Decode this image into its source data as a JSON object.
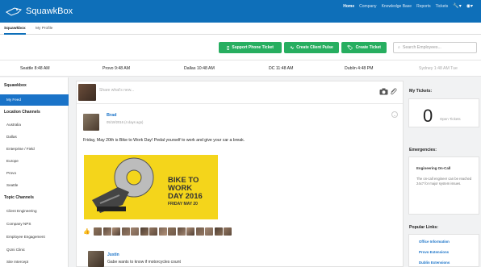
{
  "app": {
    "name": "SquawkBox"
  },
  "topnav": {
    "items": [
      "Home",
      "Company",
      "Knowledge Base",
      "Reports",
      "Tickets"
    ],
    "active": "Home",
    "tools_icon": "wrench-icon",
    "user_icon": "user-icon"
  },
  "subtabs": [
    "Squawkbox",
    "My Profile"
  ],
  "actions": {
    "phone_ticket": "Support Phone Ticket",
    "client_pulse": "Create Client Pulse",
    "create_ticket": "Create Ticket",
    "search_placeholder": "Search Employees..."
  },
  "clocks": [
    {
      "label": "Seattle 8:48 AM"
    },
    {
      "label": "Provo 9:48 AM"
    },
    {
      "label": "Dallas 10:48 AM"
    },
    {
      "label": "DC 11:48 AM"
    },
    {
      "label": "Dublin 4:48 PM"
    },
    {
      "label": "Sydney 1:48 AM Tue"
    }
  ],
  "sidebar": {
    "heading": "Squawkbox",
    "my_feed": "My Feed",
    "location_heading": "Location Channels",
    "locations": [
      "Australia",
      "Dallas",
      "Enterprise / Field",
      "Europe",
      "Provo",
      "Seattle"
    ],
    "topic_heading": "Topic Channels",
    "topics": [
      "Client Engineering",
      "Company NPS",
      "Employee Engagement",
      "QUni Clinic",
      "Site Intercept"
    ]
  },
  "composer": {
    "placeholder": "Share what's new..."
  },
  "post": {
    "author": "Brad",
    "date": "05/19/2016 (4 days ago)",
    "text": "Friday, May 20th is Bike to Work Day! Pedal yourself to work and give your car a break.",
    "banner": {
      "line1": "BIKE TO",
      "line2": "WORK",
      "line3": "DAY 2016",
      "line4": "FRIDAY MAY 20"
    },
    "like_count_faces": 15
  },
  "comment": {
    "author": "Justin",
    "text": "Gabe wants to know if motorcycles count"
  },
  "right": {
    "my_tickets": "My Tickets:",
    "ticket_count": "0",
    "open_tickets": "Open Tickets",
    "emergencies": "Emergencies:",
    "engineering_title": "Engineering On-Call",
    "engineering_text": "The on-call engineer can be reached 24x7 for major system issues.",
    "popular": "Popular Links:",
    "links": [
      "Office Information",
      "Provo Extensions",
      "Dublin Extensions"
    ]
  },
  "colors": {
    "brand": "#0e6fb9",
    "action_green": "#27ae60",
    "link_blue": "#1a73c8",
    "banner_yellow": "#f4d51b"
  }
}
